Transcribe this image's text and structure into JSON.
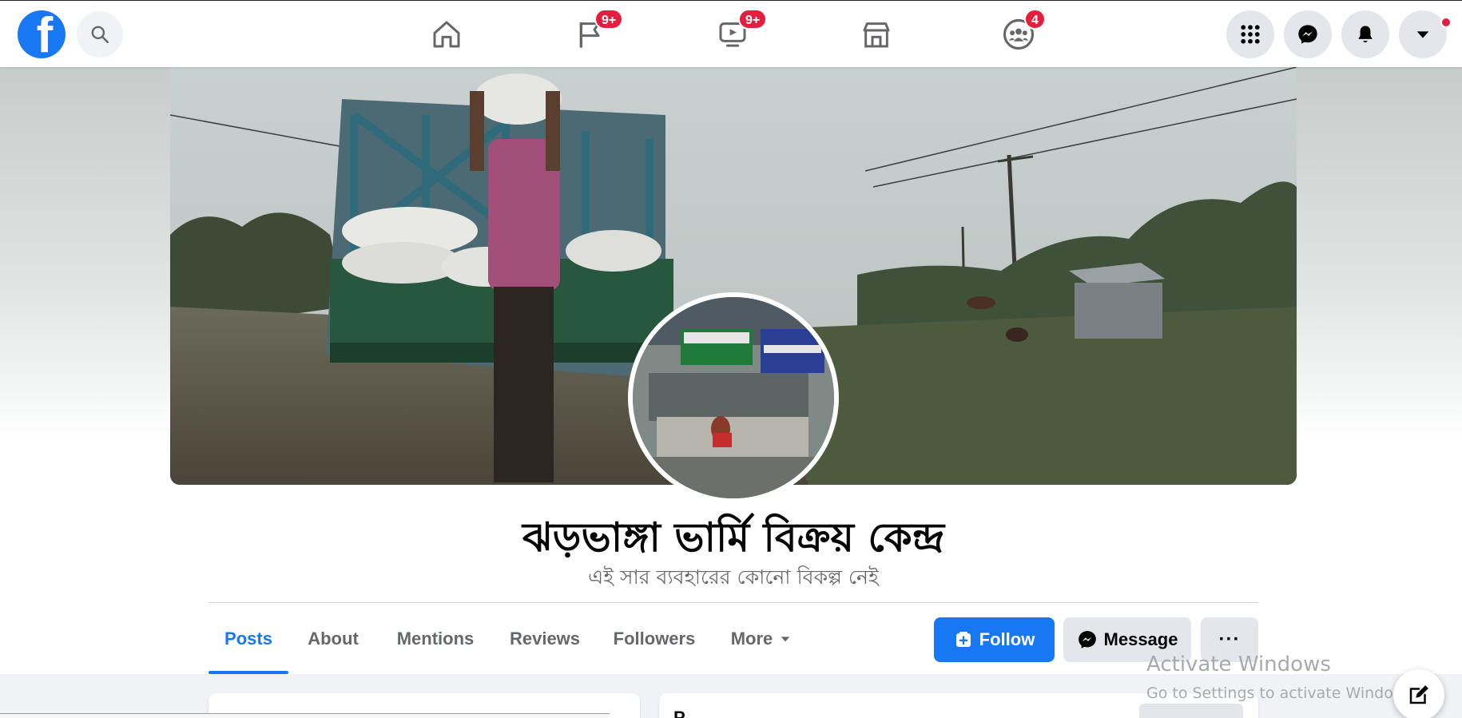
{
  "nav": {
    "logo_letter": "f",
    "badges": {
      "pages": "9+",
      "watch": "9+",
      "groups": "4"
    },
    "accent": "#1877f2",
    "badge_color": "#e41e3f"
  },
  "page": {
    "title": "ঝড়ভাঙ্গা ভার্মি বিক্রয় কেন্দ্র",
    "subtitle": "এই সার ব্যবহারের কোনো বিকল্প নেই"
  },
  "tabs": [
    "Posts",
    "About",
    "Mentions",
    "Reviews",
    "Followers",
    "More"
  ],
  "actions": {
    "follow": "Follow",
    "message": "Message",
    "more": "···"
  },
  "content": {
    "right_card_title": "P"
  },
  "watermark": {
    "line1": "Activate Windows",
    "line2": "Go to Settings to activate Windows."
  }
}
